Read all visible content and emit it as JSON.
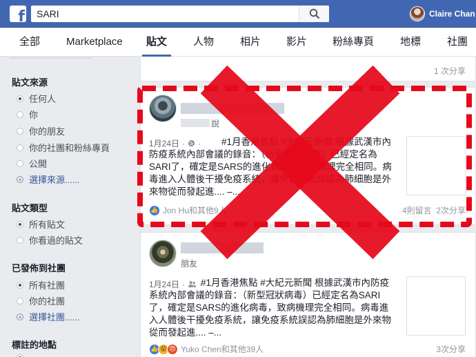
{
  "header": {
    "logo": "f",
    "search_value": "SARI",
    "user_name": "Claire Chan",
    "colors": {
      "brand": "#4267b2"
    }
  },
  "tabs": [
    {
      "label": "全部"
    },
    {
      "label": "Marketplace"
    },
    {
      "label": "貼文"
    },
    {
      "label": "人物"
    },
    {
      "label": "相片"
    },
    {
      "label": "影片"
    },
    {
      "label": "粉絲專頁"
    },
    {
      "label": "地標"
    },
    {
      "label": "社團"
    }
  ],
  "sidebar": {
    "post_source": {
      "title": "貼文來源",
      "options": [
        "任何人",
        "你",
        "你的朋友",
        "你的社團和粉絲專頁",
        "公開"
      ],
      "more": "選擇來源......"
    },
    "post_type": {
      "title": "貼文類型",
      "options": [
        "所有貼文",
        "你看過的貼文"
      ]
    },
    "posted_in_group": {
      "title": "已發佈到社團",
      "options": [
        "所有社團",
        "你的社團"
      ],
      "more": "選擇社團......"
    },
    "tagged_location": {
      "title": "標註的地點"
    }
  },
  "feed": {
    "top_card": {
      "shares": "1 次分享"
    },
    "post1": {
      "sub_visible": "說",
      "date": "1月24日",
      "text": "#1月香港焦點 #大紀元新聞 根據武漢市內防疫系統內部會議的錄音：（新型冠狀病毒）已經定名為SARI了，確定是SARS的進化病毒，致病機理完全相同。病毒進入人體後干擾免疫系統，讓免疫系統誤認為肺細胞是外來物從而發起進.... –...",
      "reactions": "Jon Hu和其他9人",
      "comments": "4則留言",
      "shares": "2次分享"
    },
    "post2": {
      "sub": "朋友",
      "date": "1月24日",
      "text": "#1月香港焦點 #大紀元新聞 根據武漢市內防疫系統內部會議的錄音：（新型冠狀病毒）已經定名為SARI了，確定是SARS的進化病毒，致病機理完全相同。病毒進入人體後干擾免疫系統，讓免疫系統誤認為肺細胞是外來物從而發起進.... –...",
      "reactions": "Yuko Chen和其他39人",
      "shares": "3次分享"
    }
  },
  "overlay": {
    "cross_color": "#e5091b",
    "dash_color": "#e5091b"
  }
}
